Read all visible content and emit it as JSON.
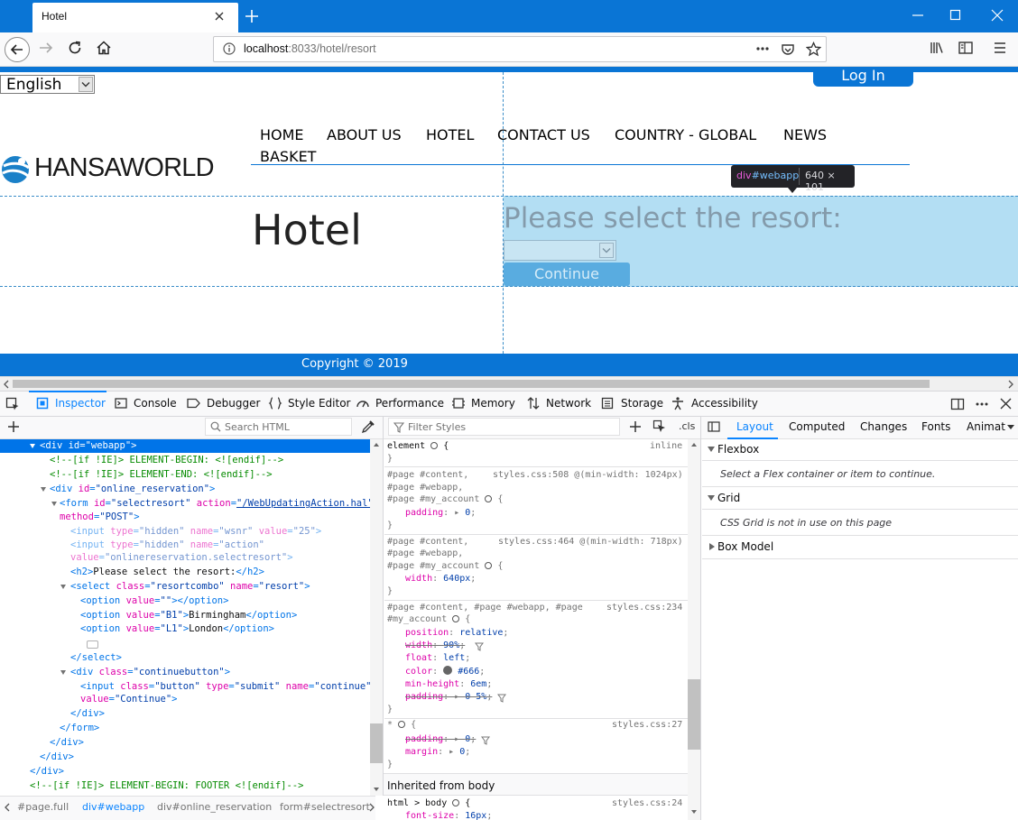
{
  "browser": {
    "tab_title": "Hotel",
    "url_host": "localhost",
    "url_rest": ":8033/hotel/resort"
  },
  "page": {
    "language_selected": "English",
    "login_label": "Log In",
    "logo_text": "HANSAWORLD",
    "menu": [
      "HOME",
      "ABOUT US",
      "HOTEL",
      "CONTACT US",
      "COUNTRY - GLOBAL",
      "NEWS",
      "BASKET"
    ],
    "heading": "Hotel",
    "resort_heading": "Please select the resort:",
    "continue_label": "Continue",
    "copyright": "Copyright © 2019",
    "highlight_tooltip": {
      "tag": "div",
      "id": "#webapp",
      "size": "640 × 101"
    }
  },
  "devtools": {
    "tabs": [
      "Inspector",
      "Console",
      "Debugger",
      "Style Editor",
      "Performance",
      "Memory",
      "Network",
      "Storage",
      "Accessibility"
    ],
    "search_html_placeholder": "Search HTML",
    "filter_styles_placeholder": "Filter Styles",
    "cls_label": ".cls",
    "right_tabs": [
      "Layout",
      "Computed",
      "Changes",
      "Fonts",
      "Animat"
    ],
    "markup": {
      "sel_line": "<div id=\"webapp\">",
      "l1": "<!--[if !IE]> ELEMENT-BEGIN: <![endif]-->",
      "l2": "<!--[if !IE]> ELEMENT-END: <![endif]-->",
      "l19": "<!--[if !IE]> ELEMENT-BEGIN: FOOTER <![endif]-->"
    },
    "layout": {
      "flexbox": "Flexbox",
      "flexbox_msg": "Select a Flex container or item to continue.",
      "grid": "Grid",
      "grid_msg": "CSS Grid is not in use on this page",
      "box_model": "Box Model"
    },
    "rules": {
      "inherited": "Inherited from body",
      "file1": "styles.css:508 @(min-width: 1024px)",
      "file2": "styles.css:464 @(min-width: 718px)",
      "file3": "styles.css:234",
      "file4": "styles.css:27",
      "file5": "styles.css:24",
      "inline": "inline"
    },
    "breadcrumbs": [
      "#page.full",
      "div#webapp",
      "div#online_reservation",
      "form#selectresort"
    ]
  }
}
